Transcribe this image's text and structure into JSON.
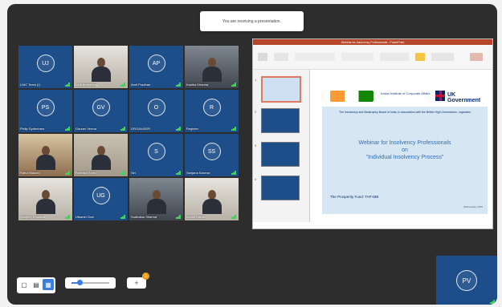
{
  "banner": {
    "text": "You are receiving a presentation."
  },
  "participants": [
    {
      "initials": "UJ",
      "name": "LNIC Team (I)",
      "kind": "avatar"
    },
    {
      "initials": "",
      "name": "Nick Armstrong",
      "kind": "photo"
    },
    {
      "initials": "AP",
      "name": "Amit Pradhan",
      "kind": "avatar"
    },
    {
      "initials": "",
      "name": "Kanika Khanna",
      "kind": "photo"
    },
    {
      "initials": "PS",
      "name": "Philip Sydenham",
      "kind": "avatar"
    },
    {
      "initials": "GV",
      "name": "Gaurav Verma",
      "kind": "avatar"
    },
    {
      "initials": "O",
      "name": "ORGANISER",
      "kind": "avatar"
    },
    {
      "initials": "R",
      "name": "Register",
      "kind": "avatar"
    },
    {
      "initials": "",
      "name": "Rahul Madan",
      "kind": "photo"
    },
    {
      "initials": "",
      "name": "Radhika Sarin",
      "kind": "photo"
    },
    {
      "initials": "S",
      "name": "Siri",
      "kind": "avatar"
    },
    {
      "initials": "SS",
      "name": "Sanjana Saxena",
      "kind": "avatar"
    },
    {
      "initials": "",
      "name": "Sanjeev Chandak",
      "kind": "photo"
    },
    {
      "initials": "UG",
      "name": "Utkarsh Goel",
      "kind": "avatar"
    },
    {
      "initials": "",
      "name": "Sudhakar Sharma",
      "kind": "photo"
    },
    {
      "initials": "",
      "name": "Ashok Haldia",
      "kind": "photo"
    }
  ],
  "presentation": {
    "window_title": "Webinar for Insolvency Professionals - PowerPoint",
    "thumb_numbers": [
      "1",
      "2",
      "3",
      "4"
    ],
    "slide": {
      "logo_iica": "Indian Institute of Corporate Affairs",
      "logo_uk": "UK Government",
      "org_text": "The Insolvency and Bankruptcy Board of India, in association with the British High Commission, organizes",
      "title_line1": "Webinar for Insolvency Professionals",
      "title_line2": "on",
      "title_line3": "\"Individual Insolvency Process\"",
      "subtitle": "The Prosperity Fund: TAP-IBB",
      "date": "Wednesday, 2020"
    }
  },
  "toolbar": {
    "add_label": "+",
    "badge_count": "1",
    "zoom_fraction": 0.22
  },
  "self_view": {
    "initials": "PV"
  },
  "colors": {
    "tile_blue": "#1d4e89",
    "accent": "#3b7ddd",
    "speaking_green": "#3fd35a"
  }
}
